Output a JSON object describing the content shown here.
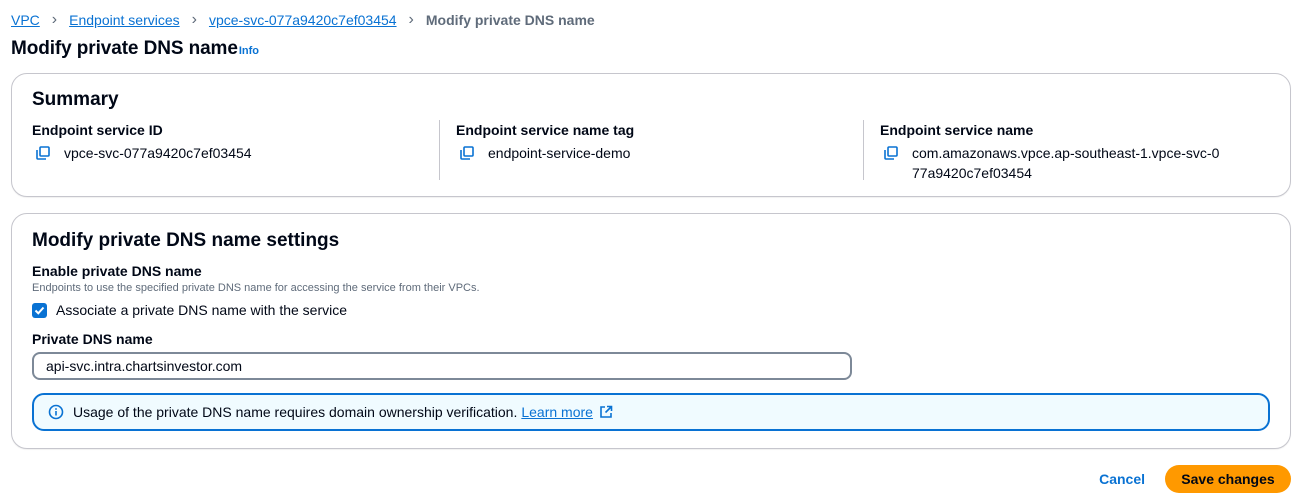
{
  "breadcrumb": {
    "items": [
      "VPC",
      "Endpoint services",
      "vpce-svc-077a9420c7ef03454"
    ],
    "current": "Modify private DNS name"
  },
  "page": {
    "title": "Modify private DNS name",
    "info_label": "Info"
  },
  "summary": {
    "heading": "Summary",
    "fields": [
      {
        "label": "Endpoint service ID",
        "value": "vpce-svc-077a9420c7ef03454"
      },
      {
        "label": "Endpoint service name tag",
        "value": "endpoint-service-demo"
      },
      {
        "label": "Endpoint service name",
        "value": "com.amazonaws.vpce.ap-southeast-1.vpce-svc-077a9420c7ef03454"
      }
    ]
  },
  "settings": {
    "heading": "Modify private DNS name settings",
    "enable_label": "Enable private DNS name",
    "enable_description": "Endpoints to use the specified private DNS name for accessing the service from their VPCs.",
    "checkbox_label": "Associate a private DNS name with the service",
    "checkbox_checked": true,
    "dns_label": "Private DNS name",
    "dns_value": "api-svc.intra.chartsinvestor.com",
    "alert_text": "Usage of the private DNS name requires domain ownership verification.",
    "alert_link": "Learn more"
  },
  "actions": {
    "cancel": "Cancel",
    "save": "Save changes"
  },
  "colors": {
    "link": "#0972d3",
    "primary_button": "#ff9900",
    "alert_border": "#0972d3",
    "alert_background": "#f0fbff"
  }
}
